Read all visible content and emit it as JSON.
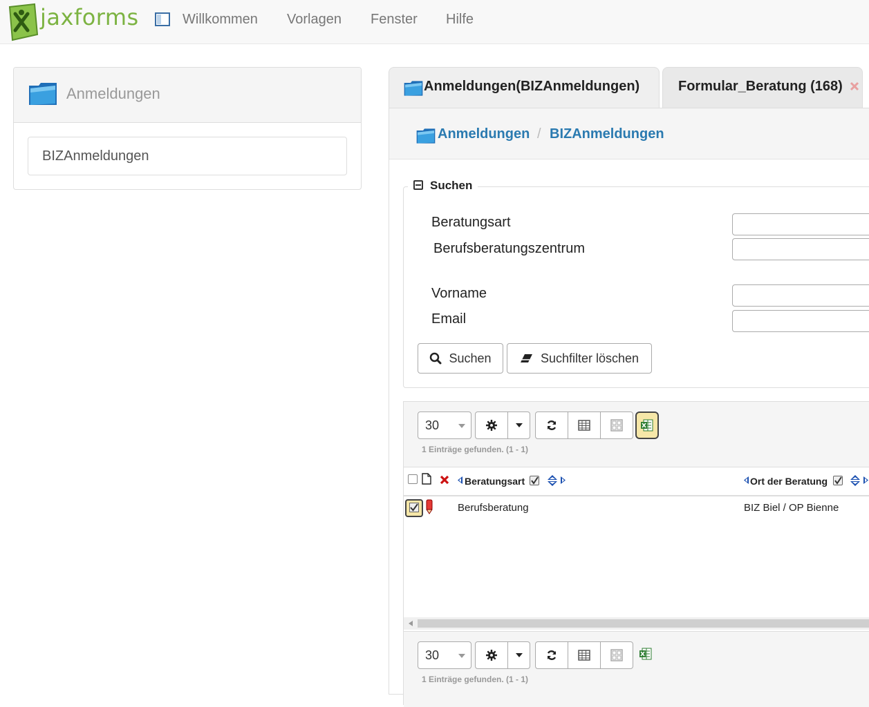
{
  "app": {
    "logo_text": "jaxforms",
    "menu": [
      "Willkommen",
      "Vorlagen",
      "Fenster",
      "Hilfe"
    ]
  },
  "sidebar": {
    "title": "Anmeldungen",
    "items": [
      "BIZAnmeldungen"
    ]
  },
  "tabs": [
    {
      "label": "Anmeldungen(BIZAnmeldungen)",
      "active": true
    },
    {
      "label": "Formular_Beratung (168)",
      "active": false
    }
  ],
  "breadcrumb": [
    "Anmeldungen",
    "BIZAnmeldungen"
  ],
  "breadcrumb_sep": "/",
  "search": {
    "legend": "Suchen",
    "fields": [
      {
        "label": "Beratungsart",
        "value": ""
      },
      {
        "label": "Berufsberatungszentrum",
        "value": ""
      },
      {
        "label": "Vorname",
        "value": ""
      },
      {
        "label": "Email",
        "value": ""
      }
    ],
    "search_button": "Suchen",
    "clear_button": "Suchfilter löschen"
  },
  "grid": {
    "page_size": "30",
    "count_text": "1 Einträge gefunden. (1 - 1)",
    "columns": [
      "Beratungsart",
      "Ort der Beratung"
    ],
    "rows": [
      {
        "cells": [
          "Berufsberatung",
          "BIZ Biel / OP Bienne"
        ],
        "selected": true
      }
    ]
  },
  "colors": {
    "brand_green": "#7cb342",
    "link_blue": "#2a7ab0",
    "delete_red": "#cc1111"
  }
}
